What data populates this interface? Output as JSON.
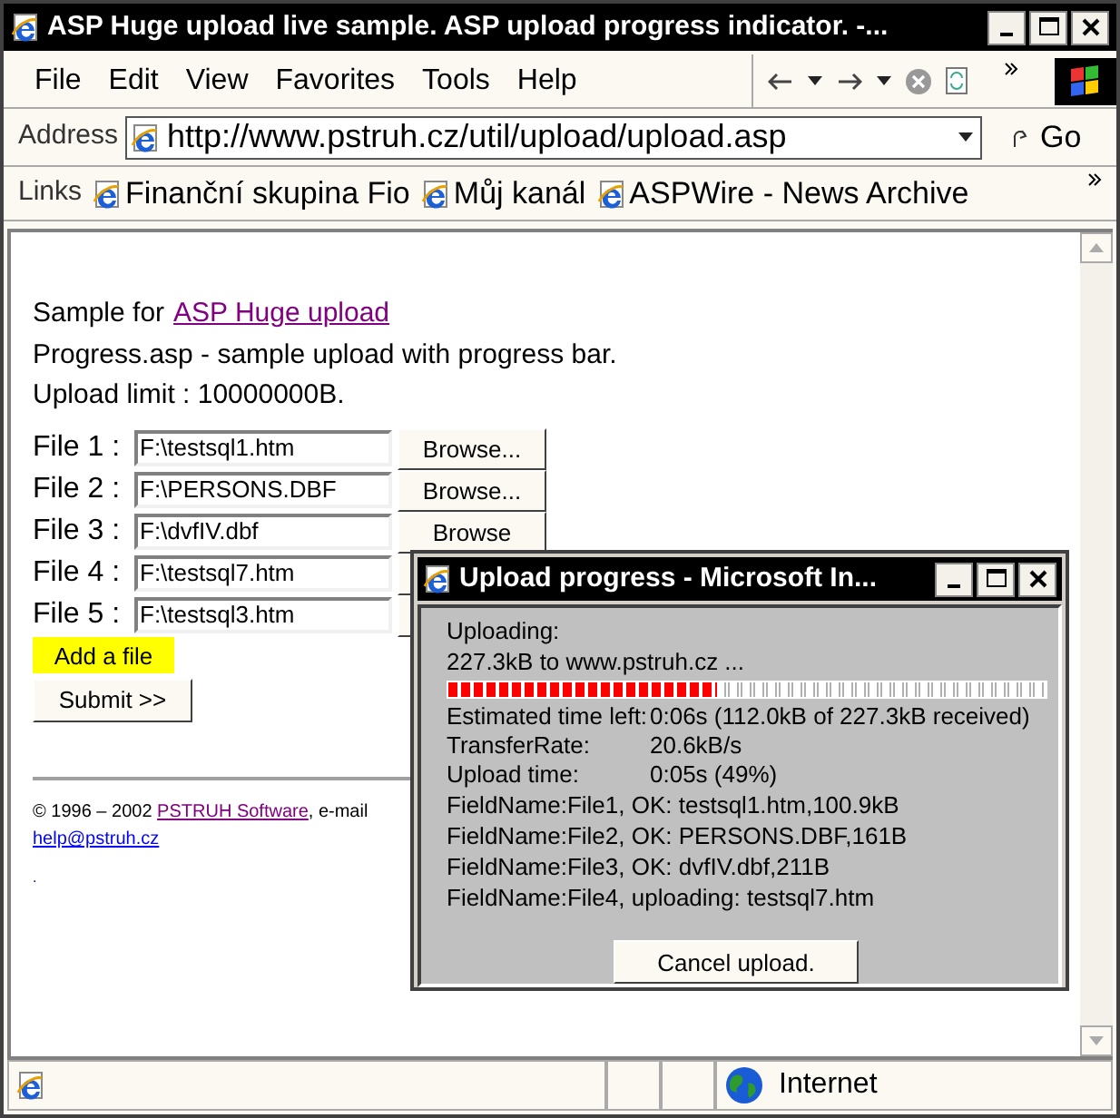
{
  "window": {
    "title": "ASP Huge upload live sample. ASP upload progress indicator. -..."
  },
  "menu": [
    "File",
    "Edit",
    "View",
    "Favorites",
    "Tools",
    "Help"
  ],
  "address": {
    "label": "Address",
    "url": "http://www.pstruh.cz/util/upload/upload.asp",
    "go": "Go"
  },
  "links": {
    "label": "Links",
    "items": [
      "Finanční skupina Fio",
      "Můj kanál",
      "ASPWire - News Archive"
    ]
  },
  "page": {
    "intro_prefix": "Sample for",
    "intro_link": "ASP Huge upload",
    "line2": "Progress.asp - sample upload with progress bar.",
    "line3": "Upload limit : 10000000B.",
    "files": [
      {
        "label": "File 1 :",
        "value": "F:\\testsql1.htm",
        "browse": "Browse..."
      },
      {
        "label": "File 2 :",
        "value": "F:\\PERSONS.DBF",
        "browse": "Browse..."
      },
      {
        "label": "File 3 :",
        "value": "F:\\dvfIV.dbf",
        "browse": "Browse"
      },
      {
        "label": "File 4 :",
        "value": "F:\\testsql7.htm"
      },
      {
        "label": "File 5 :",
        "value": "F:\\testsql3.htm"
      }
    ],
    "add_button": "Add a file",
    "submit_button": "Submit >>",
    "footer": {
      "copyright": "© 1996 – 2002",
      "company": "PSTRUH Software",
      "sep": ", e-mail",
      "email": "help@pstruh.cz",
      "dot": "."
    }
  },
  "dialog": {
    "title": "Upload progress - Microsoft In...",
    "line1": "Uploading:",
    "line2": "227.3kB to www.pstruh.cz ...",
    "level": 0.45,
    "stats": [
      {
        "label": "Estimated time left:",
        "value": "0:06s (112.0kB of 227.3kB received)"
      },
      {
        "label": "TransferRate:",
        "value": "20.6kB/s"
      },
      {
        "label": "Upload time:",
        "value": "0:05s (49%)"
      }
    ],
    "fields": [
      "FieldName:File1, OK: testsql1.htm,100.9kB",
      "FieldName:File2, OK: PERSONS.DBF,161B",
      "FieldName:File3, OK: dvfIV.dbf,211B",
      "FieldName:File4, uploading: testsql7.htm"
    ],
    "cancel": "Cancel upload."
  },
  "status_bar": {
    "zone": "Internet"
  }
}
